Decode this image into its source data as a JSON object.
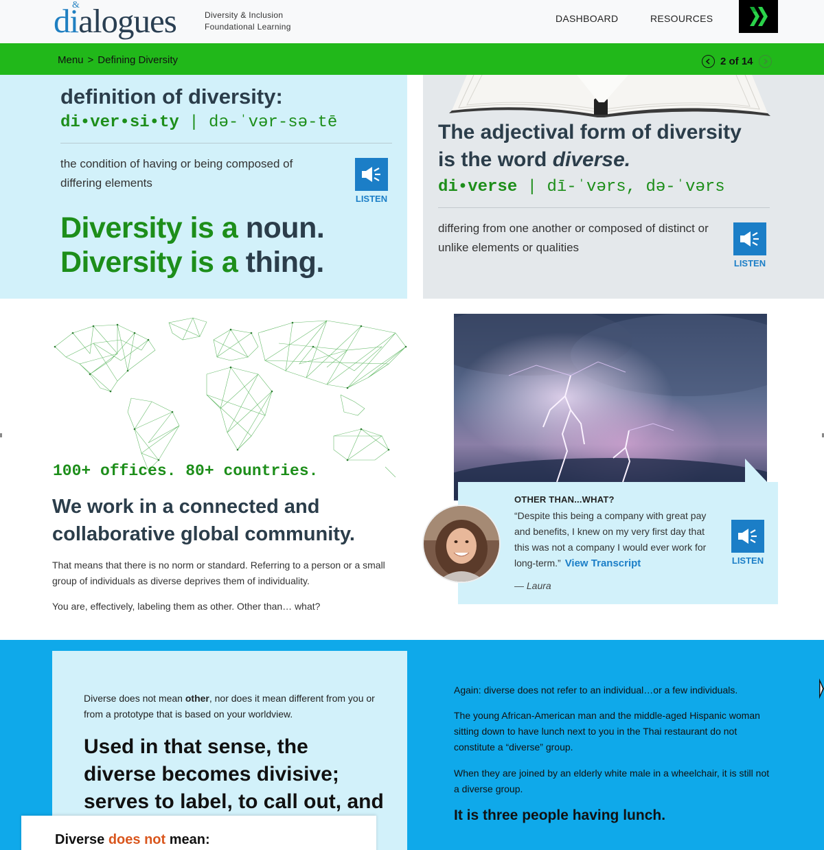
{
  "header": {
    "logo_prefix": "di",
    "logo_rest": "alogues",
    "logo_amp": "&",
    "tagline_line1": "Diversity & Inclusion",
    "tagline_line2": "Foundational Learning",
    "nav": {
      "dashboard": "DASHBOARD",
      "resources": "RESOURCES"
    },
    "brand_icon": "double-chevron-logo-icon"
  },
  "navbar": {
    "breadcrumb_menu": "Menu",
    "breadcrumb_sep": ">",
    "breadcrumb_current": "Defining Diversity",
    "pager_text": "2 of 14",
    "prev_icon": "chevron-left-icon",
    "next_icon": "chevron-right-icon"
  },
  "top_left": {
    "heading": "definition of diversity:",
    "pron_word": "di•ver•si•ty",
    "pron_sep": " | ",
    "pron_phonetic": "də-ˈvər-sə-tē",
    "definition": "the condition of having or being composed of differing elements",
    "listen_label": "LISTEN",
    "noun_line1_green": "Diversity is a",
    "noun_line1_dark": " noun.",
    "noun_line2_green": "Diversity is a",
    "noun_line2_dark": " thing."
  },
  "top_right": {
    "heading_part1": "The adjectival form of diversity is the word ",
    "heading_italic": "diverse.",
    "pron_word": "di•verse",
    "pron_sep": " | ",
    "pron_phonetic": "dī-ˈvərs, də-ˈvərs",
    "definition": "differing from one another or composed of distinct or unlike elements or qualities",
    "listen_label": "LISTEN"
  },
  "middle_left": {
    "stats": "100+ offices. 80+ countries.",
    "heading": "We work in a connected and collaborative global community.",
    "para1": "That means that there is no norm or standard. Referring to a person or a small group of individuals as diverse deprives them of individuality.",
    "para2": "You are, effectively, labeling them as other. Other than… what?"
  },
  "middle_right": {
    "quote_title": "OTHER THAN...WHAT?",
    "quote": "“Despite this being a company with great pay and benefits, I knew on my very first day that this was not a company I would ever work for long-term.”",
    "transcript_link": "View Transcript",
    "author": "— Laura",
    "listen_label": "LISTEN"
  },
  "bottom_left": {
    "p_before": "Diverse does not mean ",
    "p_bold": "other",
    "p_after": ", nor does it mean different from you or from a prototype that is based on your worldview.",
    "quote": "Used in that sense, the diverse becomes divisive; serves to label, to call out, and to depersonalize.",
    "card_title_a": "Diverse ",
    "card_title_b": "does not",
    "card_title_c": " mean:"
  },
  "bottom_right": {
    "p1": "Again: diverse does not refer to an individual…or a few individuals.",
    "p2": "The young African-American man and the middle-aged Hispanic woman sitting down to have lunch next to you in the Thai restaurant do not constitute a “diverse” group.",
    "p3": "When they are joined by an elderly white male in a wheelchair, it is still not a diverse group.",
    "conclusion": "It is three people having lunch."
  },
  "colors": {
    "green_bar": "#21b81a",
    "accent_blue": "#1b7ec7",
    "light_blue_panel": "#d2f1fa",
    "grey_panel": "#e4e8eb",
    "bottom_blue": "#0fa9ea",
    "green_text": "#1d8e1a",
    "warning_orange": "#d9561d"
  }
}
